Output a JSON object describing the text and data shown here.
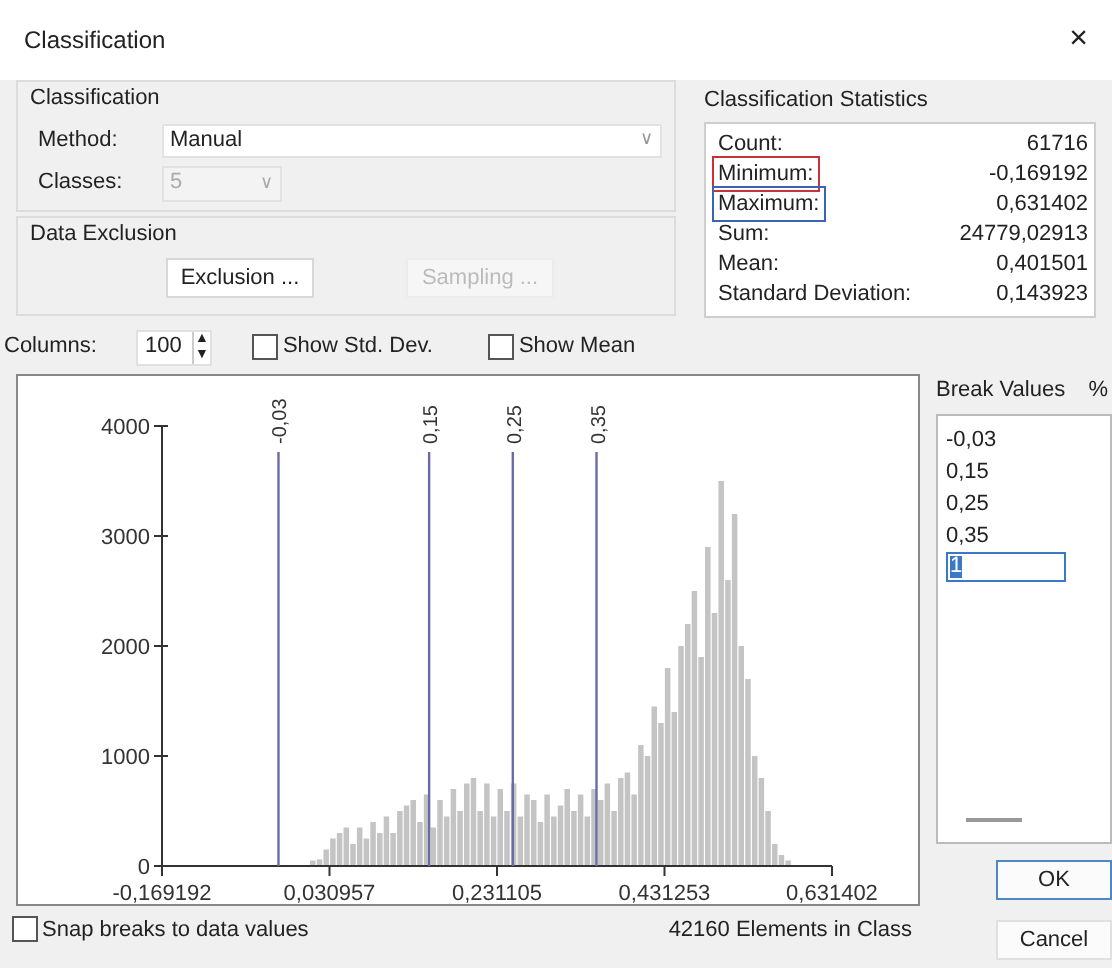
{
  "window": {
    "title": "Classification",
    "close": "×"
  },
  "classification": {
    "title": "Classification",
    "method_label": "Method:",
    "method_value": "Manual",
    "method_caret": "∨",
    "classes_label": "Classes:",
    "classes_value": "5",
    "classes_caret": "∨",
    "classes_disabled": true
  },
  "data_exclusion": {
    "title": "Data Exclusion",
    "buttons": [
      {
        "label": "Exclusion ...",
        "disabled": false
      },
      {
        "label": "Sampling ...",
        "disabled": true
      }
    ]
  },
  "statistics": {
    "title": "Classification Statistics",
    "rows": [
      {
        "label": "Count:",
        "value": "61716"
      },
      {
        "label": "Minimum:",
        "value": "-0,169192",
        "color": "#c8323c"
      },
      {
        "label": "Maximum:",
        "value": "0,631402",
        "color": "#3c64b4"
      },
      {
        "label": "Sum:",
        "value": "24779,02913"
      },
      {
        "label": "Mean:",
        "value": "0,401501"
      },
      {
        "label": "Standard Deviation:",
        "value": "0,143923"
      }
    ]
  },
  "columns": {
    "label": "Columns:",
    "value": "100",
    "up": "▲",
    "down": "▼"
  },
  "options": [
    {
      "label": "Show Std. Dev.",
      "checked": false
    },
    {
      "label": "Show Mean",
      "checked": false
    }
  ],
  "histogram": {
    "chart_data": {
      "type": "bar",
      "xlim": [
        -0.169192,
        0.631402
      ],
      "ylim": [
        0,
        4000
      ],
      "x": [
        0.011,
        0.019,
        0.027,
        0.035,
        0.043,
        0.051,
        0.059,
        0.067,
        0.075,
        0.083,
        0.091,
        0.099,
        0.107,
        0.115,
        0.123,
        0.131,
        0.139,
        0.147,
        0.155,
        0.163,
        0.171,
        0.179,
        0.187,
        0.195,
        0.203,
        0.211,
        0.219,
        0.227,
        0.235,
        0.243,
        0.251,
        0.259,
        0.267,
        0.275,
        0.283,
        0.291,
        0.299,
        0.307,
        0.315,
        0.323,
        0.331,
        0.339,
        0.347,
        0.355,
        0.363,
        0.371,
        0.379,
        0.387,
        0.395,
        0.403,
        0.411,
        0.419,
        0.427,
        0.435,
        0.443,
        0.451,
        0.459,
        0.467,
        0.475,
        0.483,
        0.491,
        0.499,
        0.507,
        0.515,
        0.523,
        0.531,
        0.539,
        0.547,
        0.555,
        0.563,
        0.571,
        0.579
      ],
      "xticks": [
        {
          "value": -0.169192,
          "label": "-0,169192"
        },
        {
          "value": 0.030957,
          "label": "0,030957"
        },
        {
          "value": 0.231105,
          "label": "0,231105"
        },
        {
          "value": 0.431253,
          "label": "0,431253"
        },
        {
          "value": 0.631402,
          "label": "0,631402"
        }
      ],
      "yticks": [
        0,
        1000,
        2000,
        3000,
        4000
      ],
      "values": [
        50,
        60,
        150,
        250,
        300,
        350,
        200,
        350,
        250,
        400,
        300,
        450,
        300,
        500,
        550,
        600,
        400,
        650,
        350,
        600,
        450,
        700,
        500,
        750,
        800,
        500,
        750,
        450,
        700,
        500,
        750,
        450,
        650,
        600,
        400,
        650,
        450,
        550,
        700,
        500,
        650,
        450,
        700,
        600,
        750,
        500,
        800,
        850,
        650,
        1100,
        1000,
        1450,
        1300,
        1800,
        1400,
        2000,
        2200,
        2500,
        1900,
        2900,
        2300,
        3500,
        2600,
        3200,
        2000,
        1700,
        1000,
        800,
        500,
        200,
        100,
        50
      ],
      "ref_lines": [
        {
          "axis": "x",
          "value": -0.03,
          "label": "-0,03"
        },
        {
          "axis": "x",
          "value": 0.15,
          "label": "0,15"
        },
        {
          "axis": "x",
          "value": 0.25,
          "label": "0,25"
        },
        {
          "axis": "x",
          "value": 0.35,
          "label": "0,35"
        }
      ]
    }
  },
  "break_values": {
    "title": "Break Values",
    "column_2": "%",
    "items": [
      "-0,03",
      "0,15",
      "0,25",
      "0,35"
    ],
    "editing_value": "1"
  },
  "snap": {
    "label": "Snap breaks to data values",
    "checked": false
  },
  "elements_in_class": "42160 Elements in Class",
  "buttons": [
    {
      "label": "OK",
      "default": true
    },
    {
      "label": "Cancel",
      "default": false
    }
  ]
}
